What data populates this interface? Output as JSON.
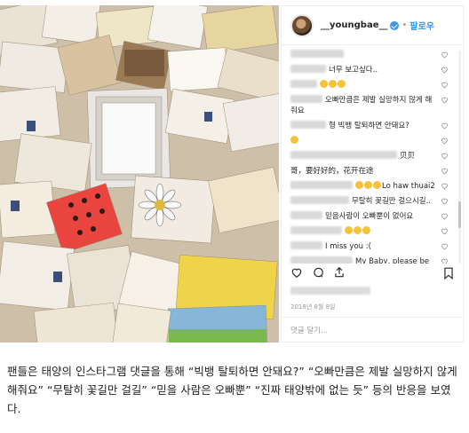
{
  "post": {
    "username": "__youngbae__",
    "follow_label": "팔로우",
    "dot": "•",
    "date": "2018년 8월 8일",
    "add_comment_placeholder": "댓글 달기..."
  },
  "comments": [
    {
      "text": "",
      "blurs": [
        60
      ],
      "emojis": 0
    },
    {
      "text": "너무 보고싶다..",
      "blurs": [
        40
      ],
      "emojis": 0
    },
    {
      "text": "",
      "blurs": [
        30
      ],
      "emojis": 3
    },
    {
      "text": "오빠만큼은 제발 실망하지 않게 해줘요",
      "blurs": [
        36
      ],
      "emojis": 0
    },
    {
      "text": "형 빅뱅 탈퇴하면 안돼요?",
      "blurs": [
        40
      ],
      "emojis": 0
    },
    {
      "text": "",
      "blurs": [],
      "emojis": 1
    },
    {
      "text": "贝贝",
      "blurs": [
        120
      ],
      "emojis": 0
    },
    {
      "text": "哥，要好好的，花开在途",
      "blurs": [],
      "emojis": 0
    },
    {
      "text": "Lo haw thuai2",
      "blurs": [
        70
      ],
      "emojis": 3
    },
    {
      "text": "무탈히 꽃길만 걸으시길..",
      "blurs": [
        66
      ],
      "emojis": 0
    },
    {
      "text": "믿음사람이 오빠뿐이 없어요",
      "blurs": [
        36
      ],
      "emojis": 0
    },
    {
      "text": "",
      "blurs": [
        58
      ],
      "emojis": 3
    },
    {
      "text": "I miss you :(",
      "blurs": [
        36
      ],
      "emojis": 0
    },
    {
      "text": "My Baby, please be safe, like I'm trying to heal and not be",
      "blurs": [
        70
      ],
      "emojis": 0
    }
  ],
  "caption": {
    "text": "팬들은 태양의 인스타그램 댓글을 통해 “빅뱅 탈퇴하면 안돼요?” “오빠만큼은 제발 실망하지 않게 해줘요” “무탈히 꽃길만 걸길” “믿을 사람은 오빠뿐” “진짜 태양밖에 없는 듯” 등의 반응을 보였다."
  },
  "icons": [
    "heart-icon",
    "comment-icon",
    "share-icon",
    "bookmark-icon",
    "verified-icon"
  ],
  "colors": {
    "accent": "#3897f0",
    "verified": "#3897f0"
  }
}
